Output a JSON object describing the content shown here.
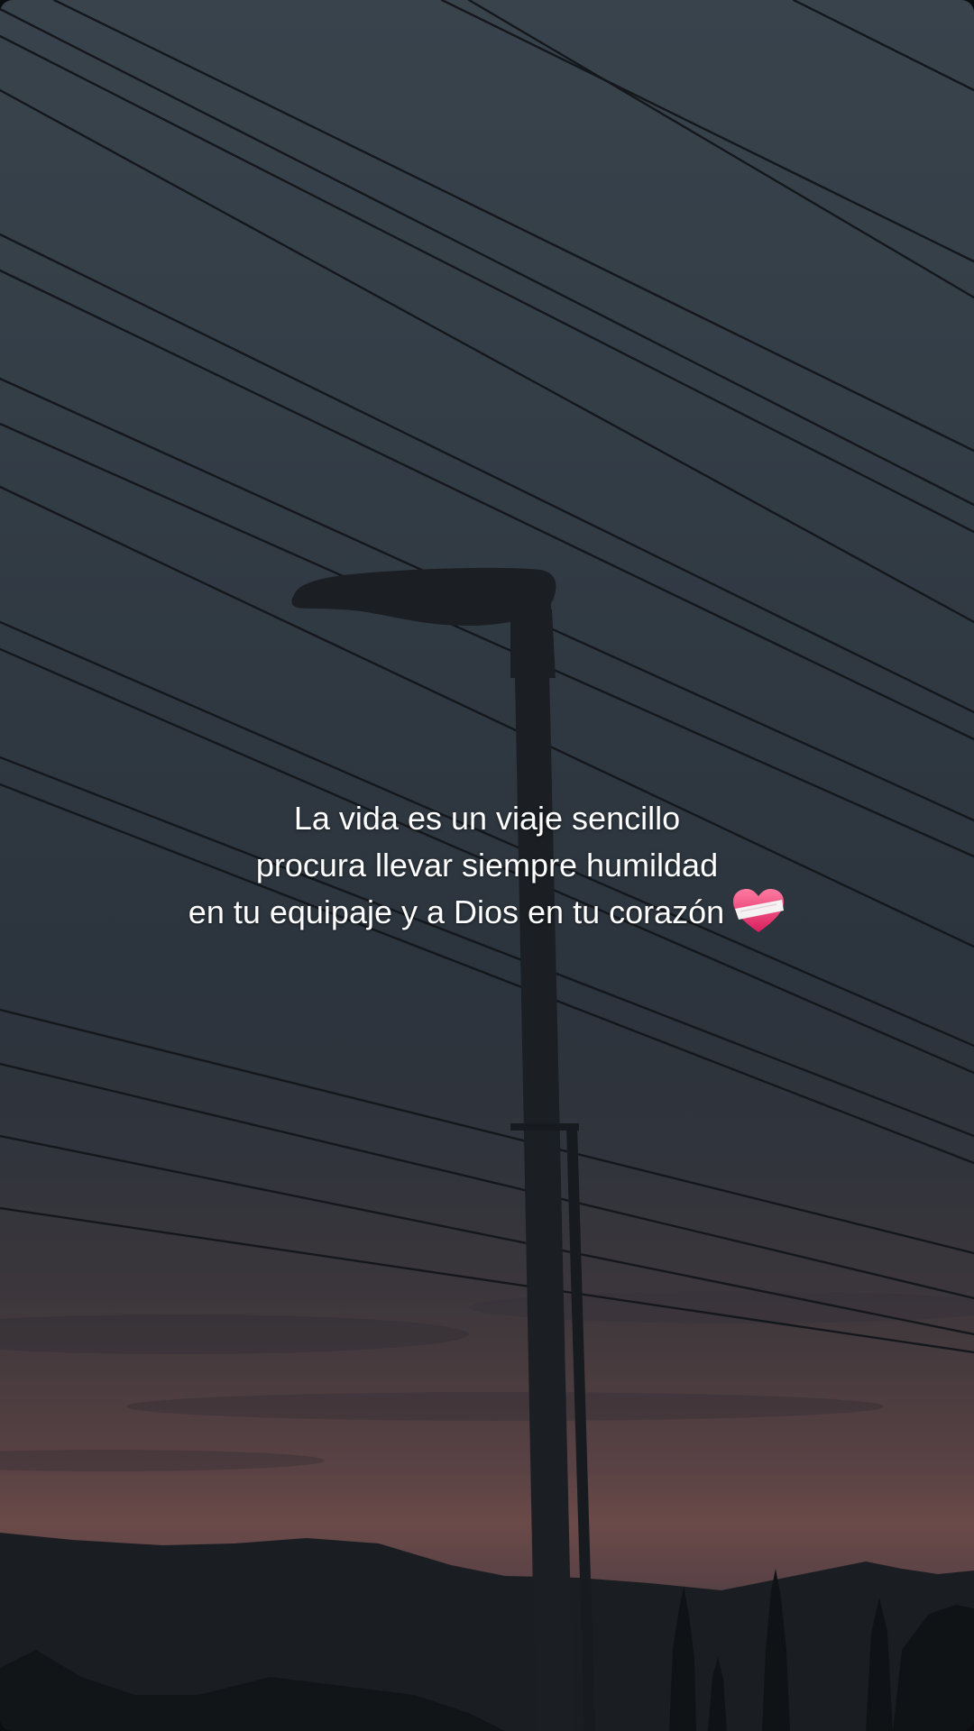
{
  "caption": {
    "line1": "La vida es un viaje sencillo",
    "line2": "procura llevar siempre humildad",
    "line3": "en tu equipaje y a Dios en tu corazón",
    "emoji_icon": "mending-heart-icon"
  },
  "colors": {
    "sky_top": "#39434c",
    "sunset": "#6a4a48",
    "silhouette": "#15181b",
    "caption_text": "#ffffff",
    "heart_pink": "#e8336f"
  }
}
